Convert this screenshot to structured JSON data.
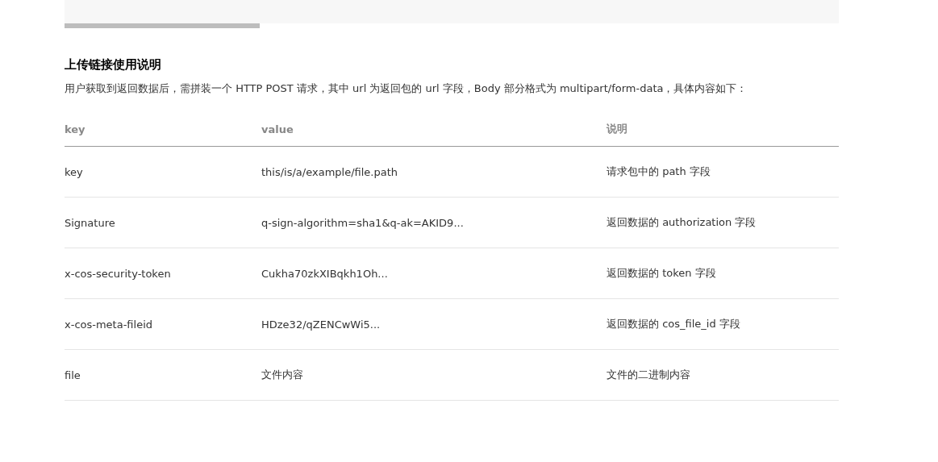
{
  "code_block": {
    "kind": "scrollable"
  },
  "section": {
    "title": "上传链接使用说明",
    "description": "用户获取到返回数据后，需拼装一个 HTTP POST 请求，其中 url 为返回包的 url 字段，Body 部分格式为 multipart/form-data，具体内容如下："
  },
  "table": {
    "columns": [
      "key",
      "value",
      "说明"
    ],
    "rows": [
      [
        "key",
        "this/is/a/example/file.path",
        "请求包中的 path 字段"
      ],
      [
        "Signature",
        "q-sign-algorithm=sha1&q-ak=AKID9...",
        "返回数据的 authorization 字段"
      ],
      [
        "x-cos-security-token",
        "Cukha70zkXIBqkh1Oh...",
        "返回数据的 token 字段"
      ],
      [
        "x-cos-meta-fileid",
        "HDze32/qZENCwWi5...",
        "返回数据的 cos_file_id 字段"
      ],
      [
        "file",
        "文件内容",
        "文件的二进制内容"
      ]
    ]
  }
}
